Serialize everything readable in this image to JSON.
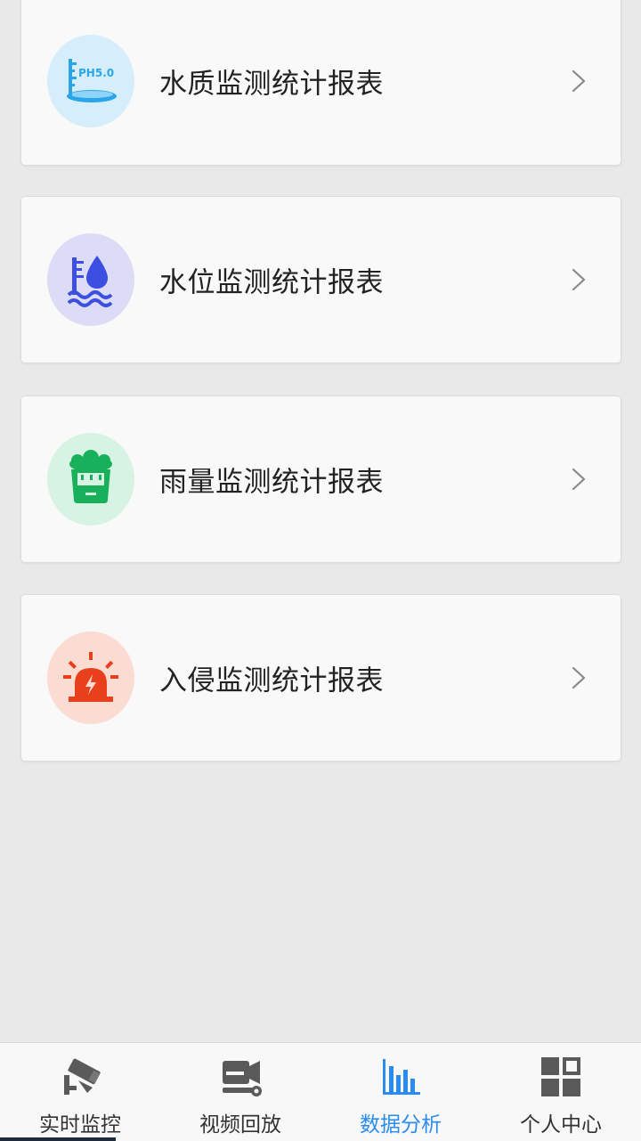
{
  "reports": [
    {
      "label": "水质监测统计报表",
      "icon": "water-quality-ph-icon",
      "icon_text": "PH5.0",
      "bg": "#d6eefb",
      "accent": "#2aa6e8"
    },
    {
      "label": "水位监测统计报表",
      "icon": "water-level-icon",
      "bg": "#dcdcf6",
      "accent": "#3c4fe0"
    },
    {
      "label": "雨量监测统计报表",
      "icon": "rain-gauge-icon",
      "bg": "#d7f3e3",
      "accent": "#19b05b"
    },
    {
      "label": "入侵监测统计报表",
      "icon": "intrusion-alarm-icon",
      "bg": "#fbdcd3",
      "accent": "#e8401c"
    }
  ],
  "tabs": [
    {
      "label": "实时监控",
      "icon": "cctv-camera-icon",
      "active": false
    },
    {
      "label": "视频回放",
      "icon": "video-playback-icon",
      "active": false
    },
    {
      "label": "数据分析",
      "icon": "bar-chart-icon",
      "active": true
    },
    {
      "label": "个人中心",
      "icon": "grid-icon",
      "active": false
    }
  ],
  "colors": {
    "background": "#e9e9e9",
    "card": "#f9f9f9",
    "active_tab": "#2a8cf0",
    "tab_icon": "#5a5a5a"
  }
}
